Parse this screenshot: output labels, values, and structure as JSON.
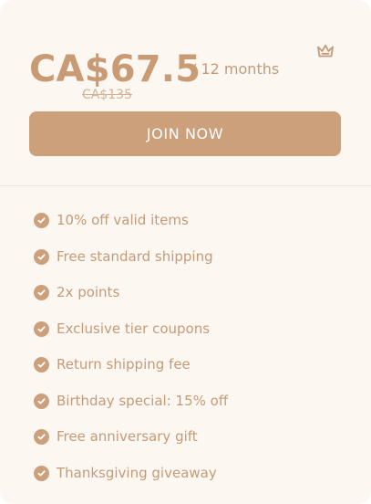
{
  "plan": {
    "price": "CA$67.5",
    "period": "/ 12 months",
    "original_price": "CA$135",
    "crown_icon": "crown-icon",
    "join_label": "JOIN NOW"
  },
  "benefits": [
    "10% off valid items",
    "Free standard shipping",
    "2x points",
    "Exclusive tier coupons",
    "Return shipping fee",
    "Birthday special: 15% off",
    "Free anniversary gift",
    "Thanksgiving giveaway"
  ],
  "colors": {
    "background": "#fdf7f2",
    "accent": "#cda07c",
    "text": "#c49b78"
  }
}
